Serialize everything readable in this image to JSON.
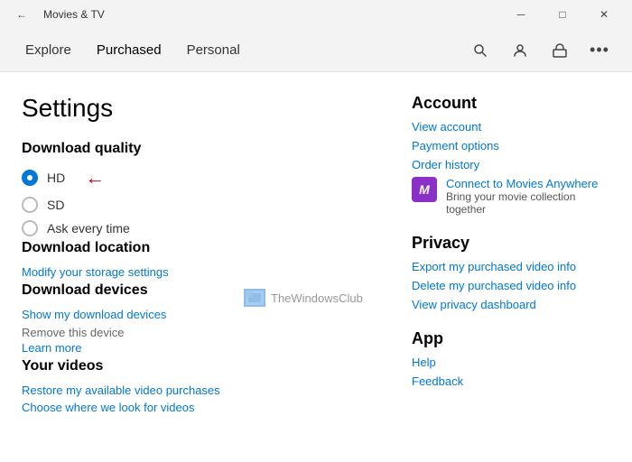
{
  "titleBar": {
    "title": "Movies & TV",
    "backBtn": "←",
    "minBtn": "─",
    "maxBtn": "□",
    "closeBtn": "✕"
  },
  "nav": {
    "links": [
      "Explore",
      "Purchased",
      "Personal"
    ],
    "activeLink": "Purchased",
    "searchIcon": "🔍",
    "accountIcon": "👤",
    "storeIcon": "🛍",
    "moreIcon": "•••"
  },
  "page": {
    "title": "Settings",
    "downloadQuality": {
      "sectionTitle": "Download quality",
      "options": [
        "HD",
        "SD",
        "Ask every time"
      ],
      "selected": "HD"
    },
    "downloadLocation": {
      "sectionTitle": "Download location",
      "link": "Modify your storage settings"
    },
    "downloadDevices": {
      "sectionTitle": "Download devices",
      "link1": "Show my download devices",
      "staticText": "Remove this device",
      "link2": "Learn more"
    },
    "yourVideos": {
      "sectionTitle": "Your videos",
      "link1": "Restore my available video purchases",
      "link2": "Choose where we look for videos"
    }
  },
  "rightPanel": {
    "account": {
      "title": "Account",
      "links": [
        "View account",
        "Payment options",
        "Order history"
      ]
    },
    "moviesAnywhere": {
      "icon": "M",
      "title": "Connect to Movies Anywhere",
      "subtitle": "Bring your movie collection together"
    },
    "privacy": {
      "title": "Privacy",
      "links": [
        "Export my purchased video info",
        "Delete my purchased video info",
        "View privacy dashboard"
      ]
    },
    "app": {
      "title": "App",
      "links": [
        "Help",
        "Feedback"
      ]
    }
  },
  "watermark": {
    "icon": "🖼",
    "text": "TheWindowsClub"
  }
}
